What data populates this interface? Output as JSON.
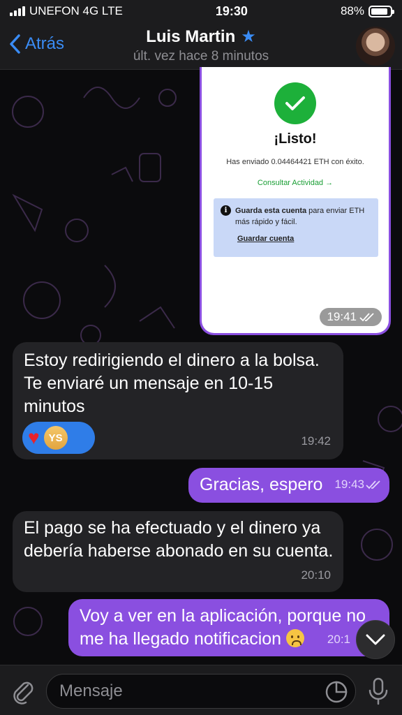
{
  "status_bar": {
    "carrier": "UNEFON 4G  LTE",
    "time": "19:30",
    "battery": "88%",
    "battery_level": 0.88
  },
  "header": {
    "back_label": "Atrás",
    "name": "Luis Martin",
    "last_seen": "últ. vez hace 8 minutos"
  },
  "image_message": {
    "title": "¡Listo!",
    "sent_text": "Has enviado 0.04464421 ETH con éxito.",
    "activity_link": "Consultar Actividad →",
    "save_text_bold": "Guarda esta cuenta",
    "save_text_rest": " para enviar ETH más rápido y fácil.",
    "save_link": "Guardar cuenta",
    "time": "19:41"
  },
  "messages": [
    {
      "direction": "in",
      "text": "Estoy redirigiendo el dinero a la bolsa. Te enviaré un mensaje en 10-15 minutos",
      "time": "19:42",
      "reactions": [
        "heart",
        "YS"
      ]
    },
    {
      "direction": "out",
      "text": "Gracias, espero",
      "time": "19:43"
    },
    {
      "direction": "in",
      "text": "El pago se ha efectuado y el dinero ya debería haberse abonado en su cuenta.",
      "time": "20:10"
    },
    {
      "direction": "out",
      "text": "Voy a ver en la aplicación, porque no me ha llegado notificacion",
      "time": "20:1",
      "emoji": "worried-face"
    }
  ],
  "reaction_badge": "YS",
  "input": {
    "placeholder": "Mensaje"
  },
  "colors": {
    "accent": "#3a8cf5",
    "outgoing": "#8a4fe0",
    "incoming": "#232326",
    "background": "#0b0b0d"
  }
}
